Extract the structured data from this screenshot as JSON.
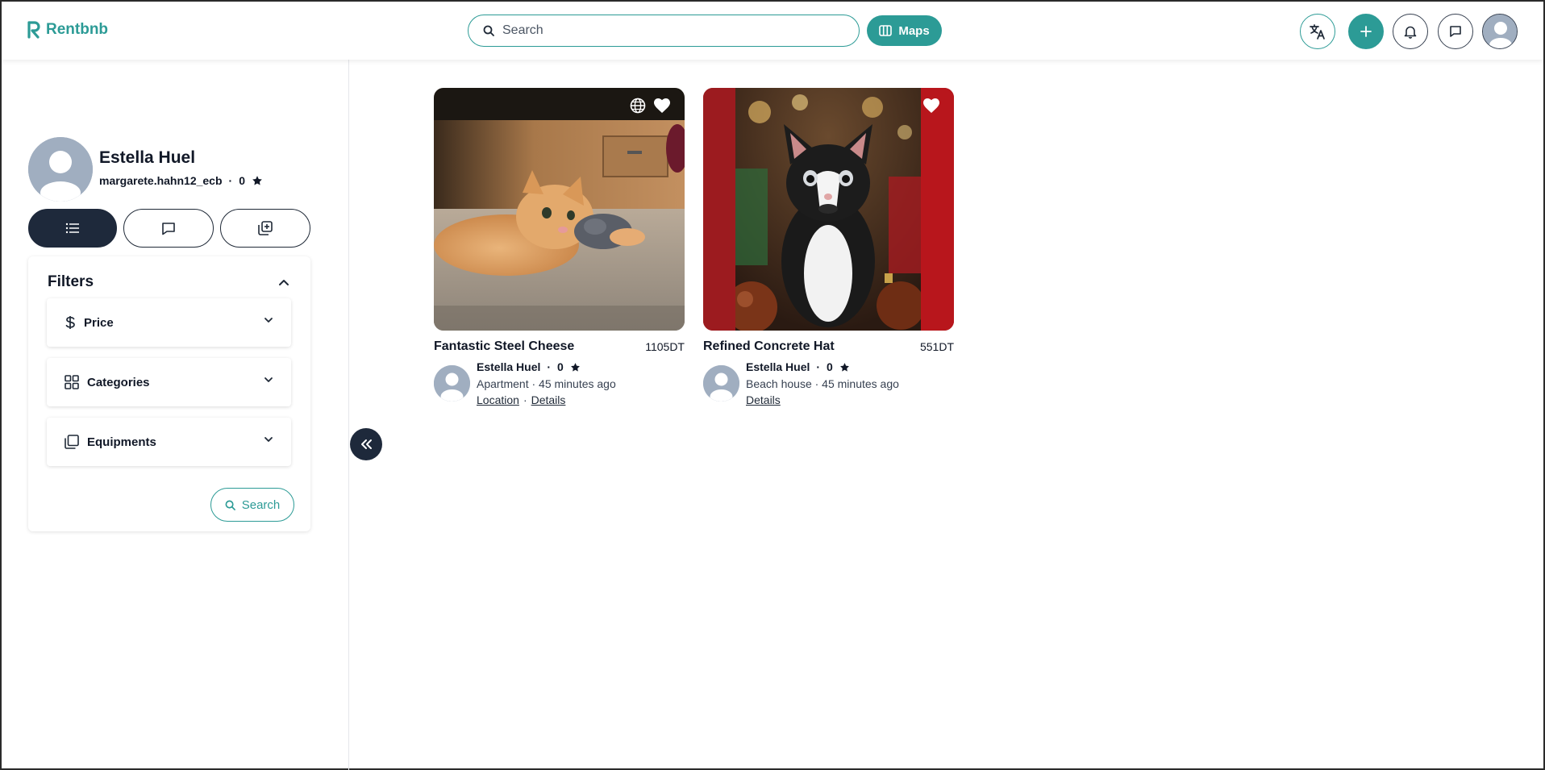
{
  "header": {
    "logo_text": "Rentbnb",
    "search_placeholder": "Search",
    "maps_label": "Maps",
    "icons": [
      "translate-icon",
      "plus-icon",
      "bell-icon",
      "chat-icon",
      "avatar"
    ]
  },
  "profile": {
    "name": "Estella Huel",
    "username": "margarete.hahn12_ecb",
    "rating": "0"
  },
  "tabs": [
    "list-icon",
    "chat-icon",
    "add-box-icon"
  ],
  "filters": {
    "title": "Filters",
    "items": [
      {
        "label": "Price",
        "icon": "dollar-icon"
      },
      {
        "label": "Categories",
        "icon": "grid-icon"
      },
      {
        "label": "Equipments",
        "icon": "copy-icon"
      }
    ],
    "search_label": "Search"
  },
  "listings": [
    {
      "title": "Fantastic Steel Cheese",
      "price": "1105DT",
      "host": "Estella Huel",
      "rating": "0",
      "category": "Apartment",
      "time": "45 minutes ago",
      "sub": "Apartment · 45 minutes ago",
      "links": [
        "Location",
        "Details"
      ],
      "image": "orange-cat"
    },
    {
      "title": "Refined Concrete Hat",
      "price": "551DT",
      "host": "Estella Huel",
      "rating": "0",
      "category": "Beach house",
      "time": "45 minutes ago",
      "sub": "Beach house · 45 minutes ago",
      "links": [
        "Details"
      ],
      "image": "black-white-kitten"
    }
  ],
  "colors": {
    "brand": "#2c9b96",
    "dark": "#1e293b",
    "avatar_bg": "#a0aec0"
  }
}
